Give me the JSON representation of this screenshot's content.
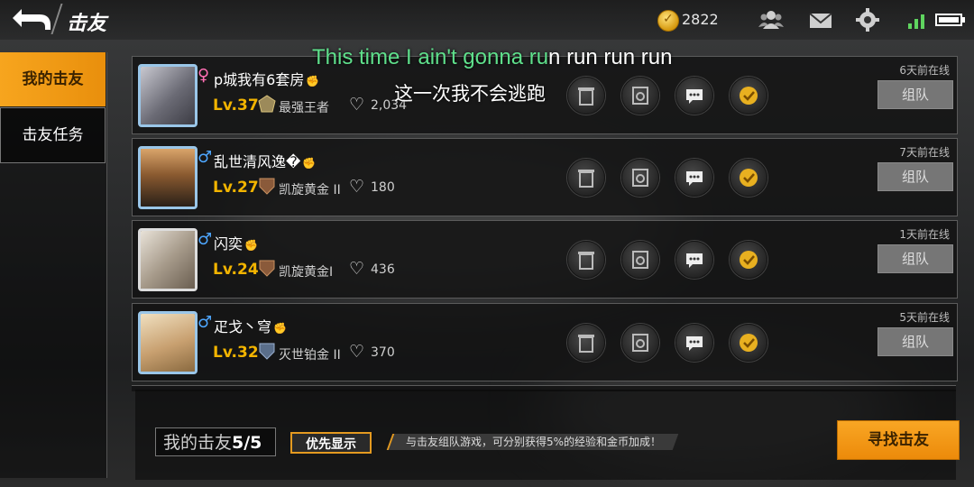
{
  "header": {
    "title": "击友",
    "coins": "2822"
  },
  "nav": {
    "items": [
      {
        "label": "我的击友",
        "active": true
      },
      {
        "label": "击友任务",
        "active": false
      }
    ]
  },
  "friends": [
    {
      "gender": "♀",
      "name": "p城我有6套房",
      "level": "Lv.37",
      "rank": "最强王者",
      "likes": "2,034",
      "online": "6天前在线",
      "team": "组队",
      "avatar_color": "#8a8a92"
    },
    {
      "gender": "♂",
      "name": "乱世清风逸",
      "name_suffix": "�",
      "level": "Lv.27",
      "rank": "凯旋黄金 II",
      "likes": "180",
      "online": "7天前在线",
      "team": "组队",
      "avatar_color": "#6b5a45"
    },
    {
      "gender": "♂",
      "name": "闪奕",
      "level": "Lv.24",
      "rank": "凯旋黄金I",
      "likes": "436",
      "online": "1天前在线",
      "team": "组队",
      "avatar_color": "#c9c2b8"
    },
    {
      "gender": "♂",
      "name": "疋戈丶穹",
      "level": "Lv.32",
      "rank": "灭世铂金 II",
      "likes": "370",
      "online": "5天前在线",
      "team": "组队",
      "avatar_color": "#b9a27e"
    }
  ],
  "footer": {
    "count_label": "我的击友",
    "count_value": "5/5",
    "priority": "优先显示",
    "tip": "与击友组队游戏，可分别获得5%的经验和金币加成！",
    "find": "寻找击友"
  },
  "subtitle": {
    "en_highlight": "This time I ain't gonna ru",
    "en_rest": "n run run run",
    "zh": "这一次我不会逃跑"
  },
  "colors": {
    "accent": "#f2a21a",
    "level": "#f2b400",
    "female": "#ff6fb4",
    "male": "#4ea7ff"
  }
}
